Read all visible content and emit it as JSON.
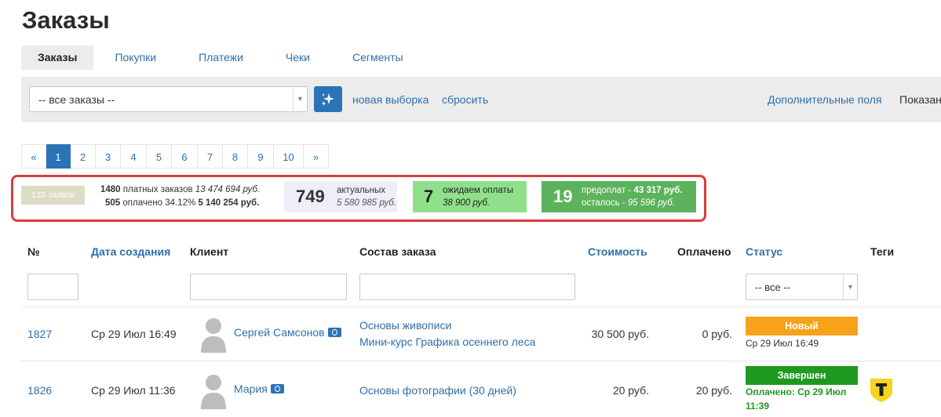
{
  "page": {
    "title": "Заказы"
  },
  "tabs": [
    {
      "label": "Заказы",
      "active": true
    },
    {
      "label": "Покупки"
    },
    {
      "label": "Платежи"
    },
    {
      "label": "Чеки"
    },
    {
      "label": "Сегменты"
    }
  ],
  "filter": {
    "select_value": "-- все заказы --",
    "magic_icon": "sparkle-icon",
    "new_selection": "новая выборка",
    "reset": "сбросить",
    "extra_fields": "Дополнительные поля",
    "show_label": "Показан"
  },
  "pagination": {
    "prev": "«",
    "pages": [
      "1",
      "2",
      "3",
      "4",
      "5",
      "6",
      "7",
      "8",
      "9",
      "10"
    ],
    "current": "1",
    "next": "»"
  },
  "stats": {
    "requests": "133 заявок",
    "paid_count": "1480",
    "paid_label": "платных заказов",
    "paid_sum": "13 474 694 руб.",
    "paid_done_count": "505",
    "paid_done_label": "оплачено 34.12%",
    "paid_done_sum": "5 140 254 руб.",
    "actual_count": "749",
    "actual_label": "актуальных",
    "actual_sum": "5 580 985 руб.",
    "waiting_count": "7",
    "waiting_label": "ожидаем оплаты",
    "waiting_sum": "38 900 руб.",
    "prepay_count": "19",
    "prepay_label": "предоплат - ",
    "prepay_sum": "43 317 руб.",
    "left_label": "осталось - ",
    "left_sum": "95 596 руб.",
    "colors": {
      "frame": "#d93d3d",
      "waiting": "#8fe08b",
      "prepay": "#5cb35c"
    }
  },
  "table": {
    "headers": {
      "num": "№",
      "created": "Дата создания",
      "client": "Клиент",
      "composition": "Состав заказа",
      "cost": "Стоимость",
      "paid": "Оплачено",
      "status": "Статус",
      "tags": "Теги"
    },
    "status_filter": "-- все --",
    "rows": [
      {
        "id": "1827",
        "date": "Ср 29 Июл 16:49",
        "client": "Сергей Самсонов",
        "items": [
          "Основы живописи",
          "Мини-курс Графика осеннего леса"
        ],
        "cost": "30 500 руб.",
        "paid": "0 руб.",
        "status": "Новый",
        "status_note": "Ср 29 Июл 16:49"
      },
      {
        "id": "1826",
        "date": "Ср 29 Июл 11:36",
        "client": "Мария",
        "items": [
          "Основы фотографии (30 дней)"
        ],
        "cost": "20 руб.",
        "paid": "20 руб.",
        "status": "Завершен",
        "status_note_1": "Оплачено: Ср 29 Июл",
        "status_note_2": "11:39",
        "tag_icon": "t-shield-icon"
      }
    ]
  }
}
